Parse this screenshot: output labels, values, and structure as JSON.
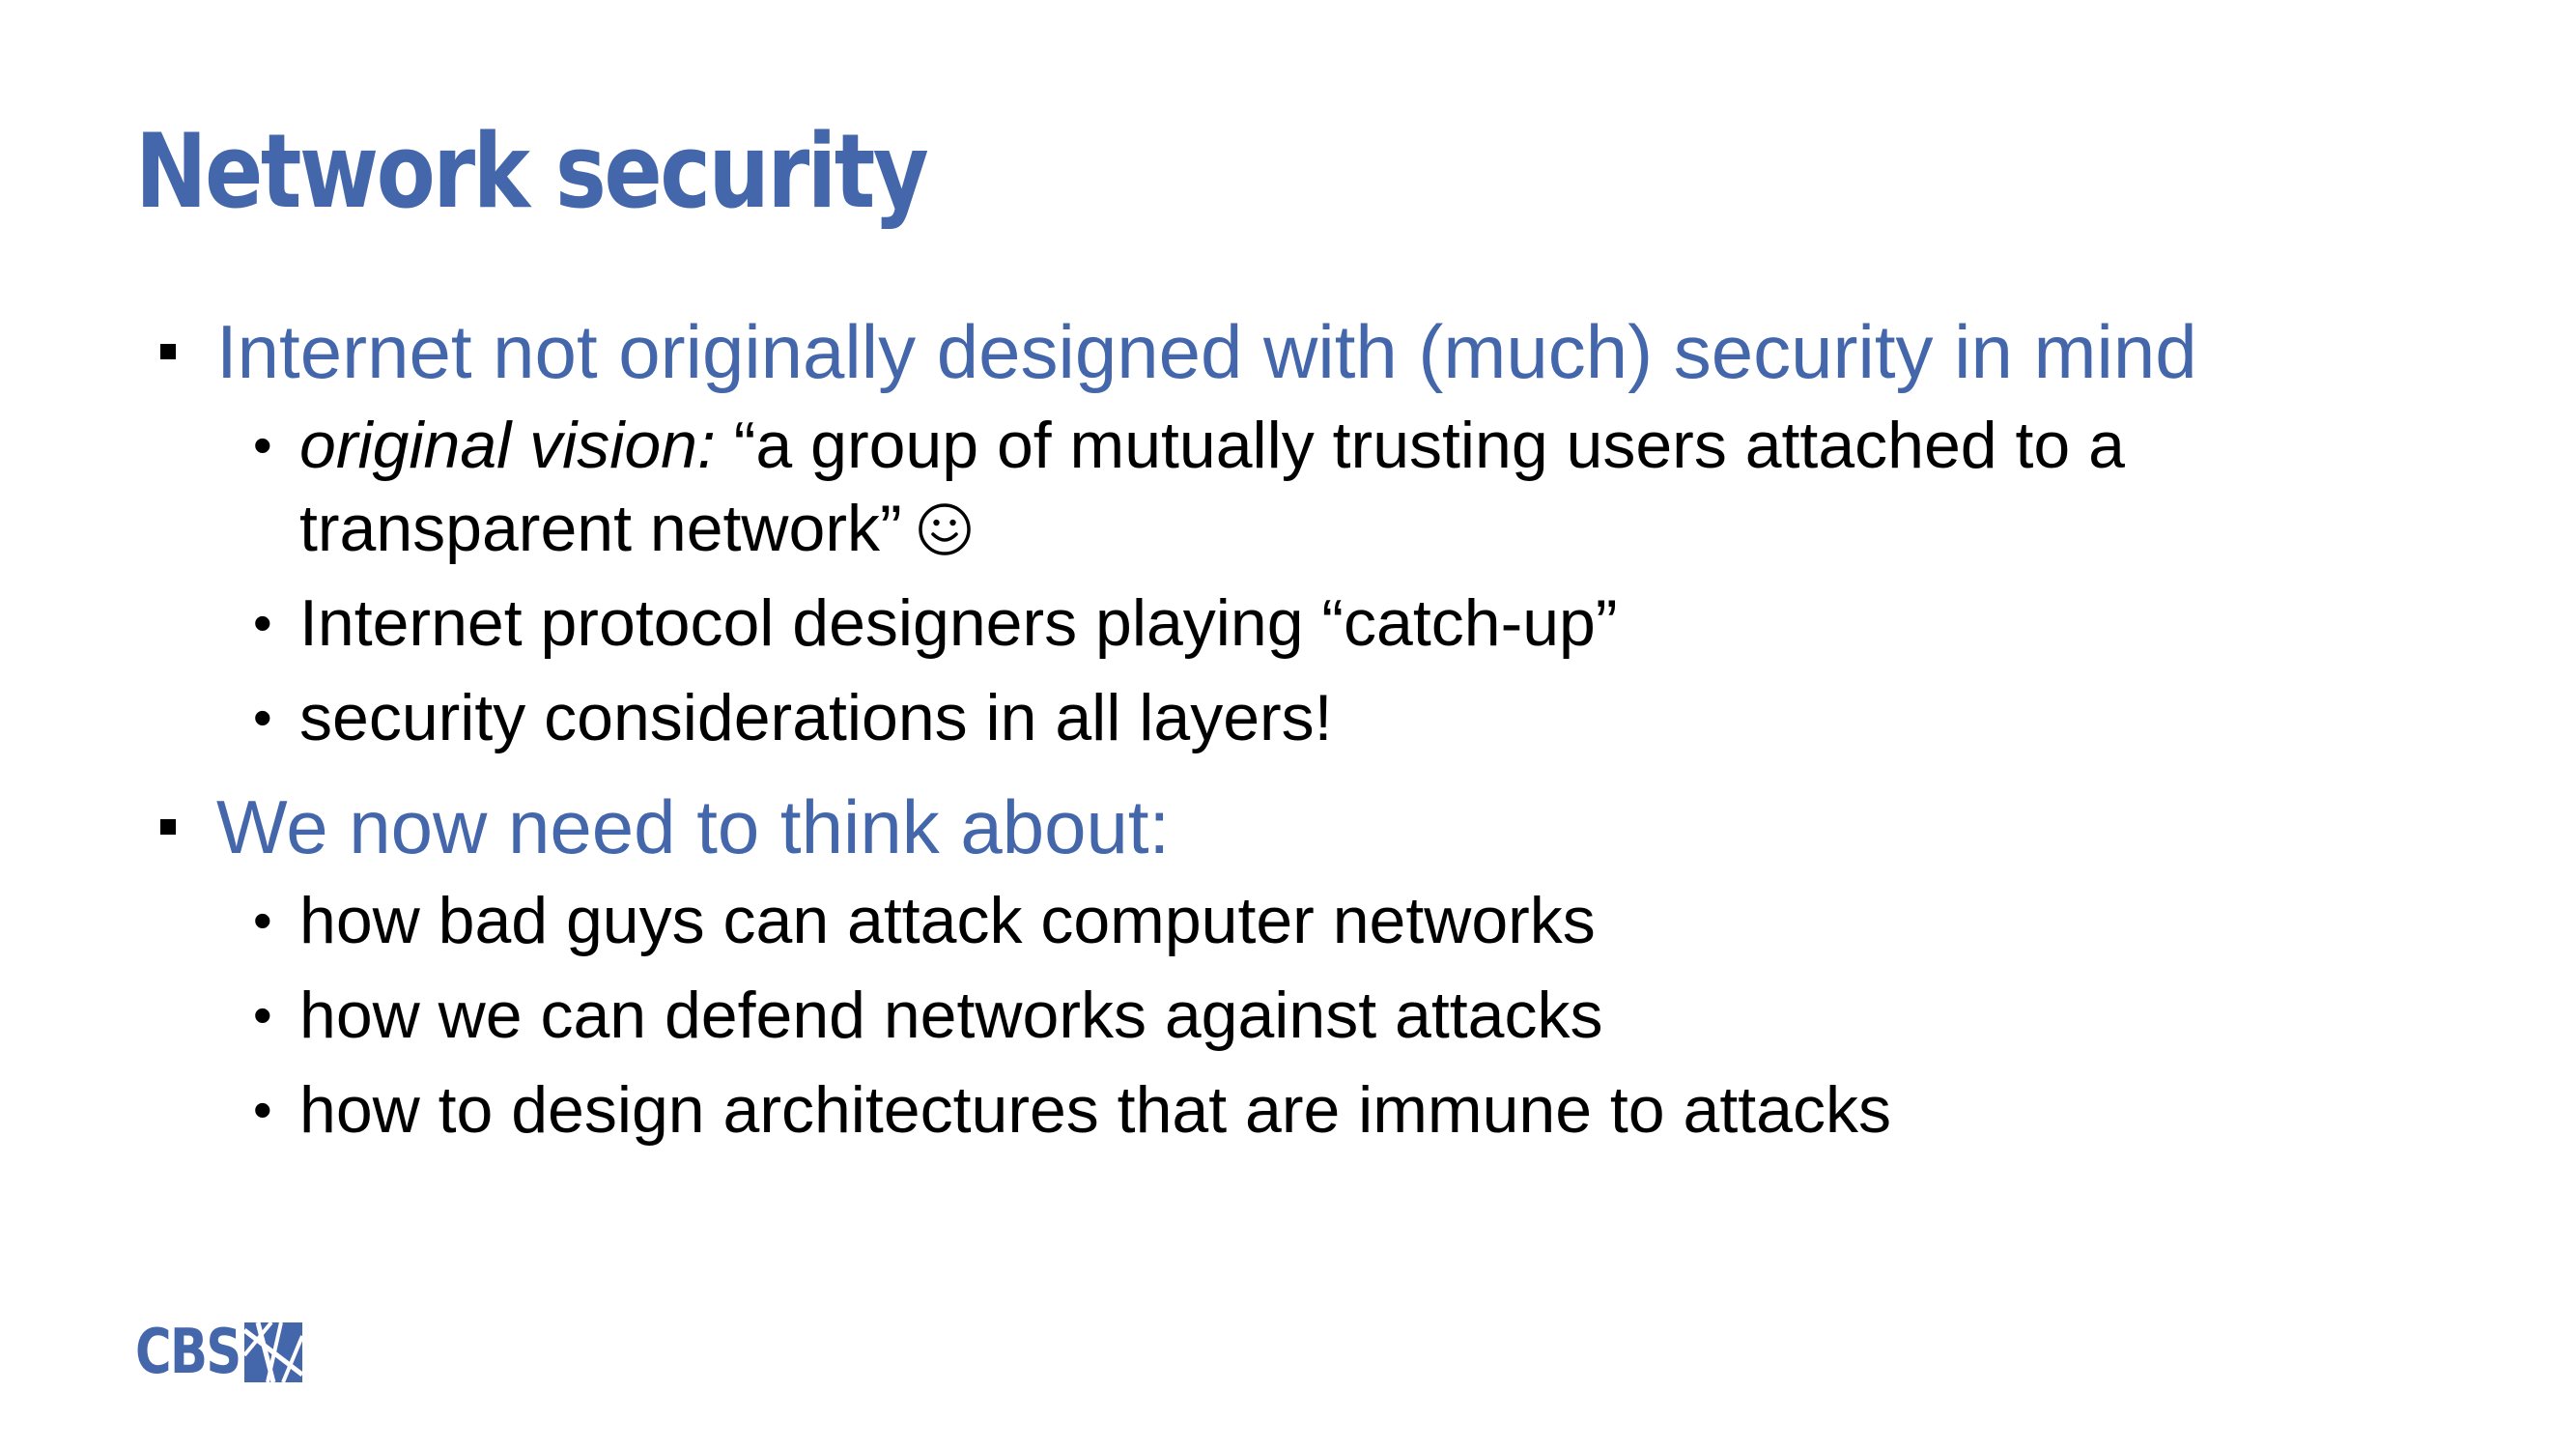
{
  "slide": {
    "title": "Network security",
    "sections": [
      {
        "heading": "Internet not originally designed with (much) security in mind",
        "bullets": [
          {
            "italic_prefix": "original vision:",
            "text_line1": " “a group of mutually trusting users attached to a",
            "text_line2": "transparent network”"
          },
          {
            "text": "Internet protocol designers playing “catch-up”"
          },
          {
            "text": "security considerations in all layers!"
          }
        ]
      },
      {
        "heading": "We now need to think about:",
        "bullets": [
          {
            "text": "how bad guys can attack computer networks"
          },
          {
            "text": "how we can defend networks against attacks"
          },
          {
            "text": "how to design architectures that are immune to attacks"
          }
        ]
      }
    ],
    "logo": "CBS",
    "icons": {
      "level1_bullet": "square-bullet-icon",
      "level2_bullet": "round-bullet-icon",
      "emoticon": "smiley-face-icon",
      "logo_mark": "cbs-logo-mark-icon"
    },
    "colors": {
      "accent": "#4466aa",
      "body_text": "#000000",
      "background": "#ffffff"
    }
  }
}
